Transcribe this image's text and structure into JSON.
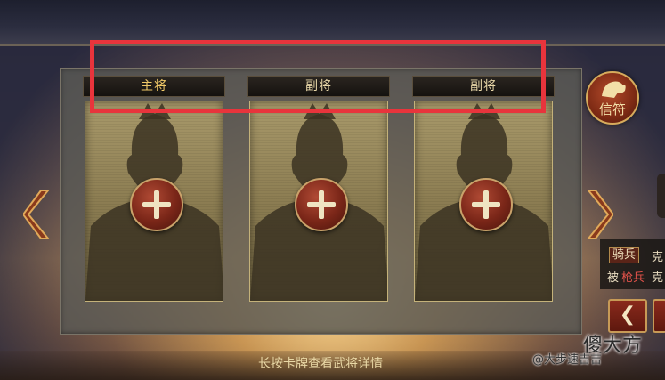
{
  "slots": [
    {
      "label": "主将"
    },
    {
      "label": "副将"
    },
    {
      "label": "副将"
    }
  ],
  "token": {
    "label": "信符",
    "icon": "qilin-emblem-icon"
  },
  "info": {
    "tag": "骑兵",
    "line1_tail": "克",
    "line2_prefix": "被",
    "line2_red": "枪兵",
    "line2_tail": "克"
  },
  "nav": {
    "prev_icon": "chevron-left-icon",
    "prev_glyph": "❮"
  },
  "hint": "长按卡牌查看武将详情",
  "watermark": {
    "big": "傻大方",
    "small": "@大步速吉吉"
  },
  "colors": {
    "accent_red": "#e8343c",
    "gold_text": "#f0c968",
    "card_gold": "#a8996a"
  }
}
